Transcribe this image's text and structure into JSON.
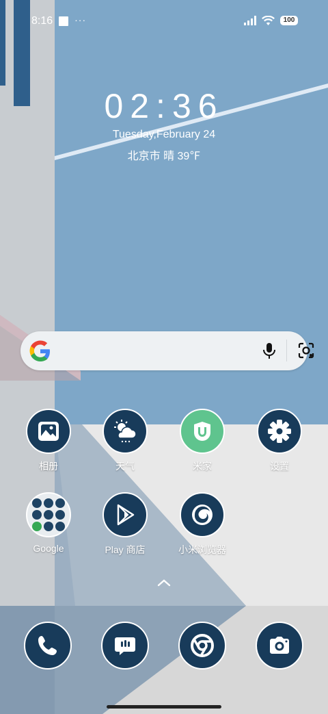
{
  "status_bar": {
    "time": "8:16",
    "dots": "···",
    "battery": "100"
  },
  "lock": {
    "clock": "02:36",
    "date": "Tuesday,February 24",
    "weather": "北京市 晴 39℉"
  },
  "search": {
    "logo": "google-g-icon",
    "mic": "mic-icon",
    "lens": "lens-icon"
  },
  "apps": [
    {
      "label": "相册",
      "icon": "gallery-icon"
    },
    {
      "label": "天气",
      "icon": "weather-icon"
    },
    {
      "label": "米家",
      "icon": "mijia-icon"
    },
    {
      "label": "设置",
      "icon": "settings-icon"
    },
    {
      "label": "Google",
      "icon": "google-folder-icon"
    },
    {
      "label": "Play 商店",
      "icon": "play-store-icon"
    },
    {
      "label": "小米浏览器",
      "icon": "browser-icon"
    }
  ],
  "dock": [
    {
      "icon": "phone-icon"
    },
    {
      "icon": "messages-icon"
    },
    {
      "icon": "chrome-icon"
    },
    {
      "icon": "camera-icon"
    }
  ],
  "colors": {
    "icon_bg": "#183b5a",
    "mijia_bg": "#5fc48e",
    "wallpaper_sky": "#7ea7c8"
  }
}
